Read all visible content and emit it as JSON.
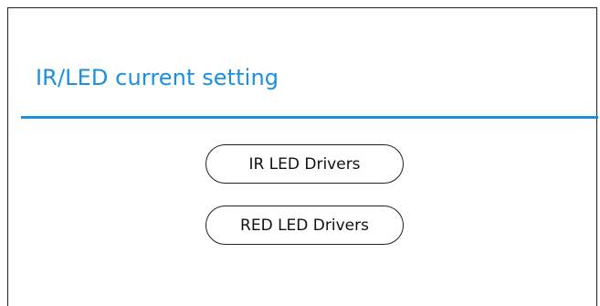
{
  "dialog": {
    "title": "IR/LED current setting",
    "accent_color": "#1a8fe3",
    "buttons": [
      {
        "label": "IR LED Drivers"
      },
      {
        "label": "RED LED Drivers"
      }
    ]
  }
}
